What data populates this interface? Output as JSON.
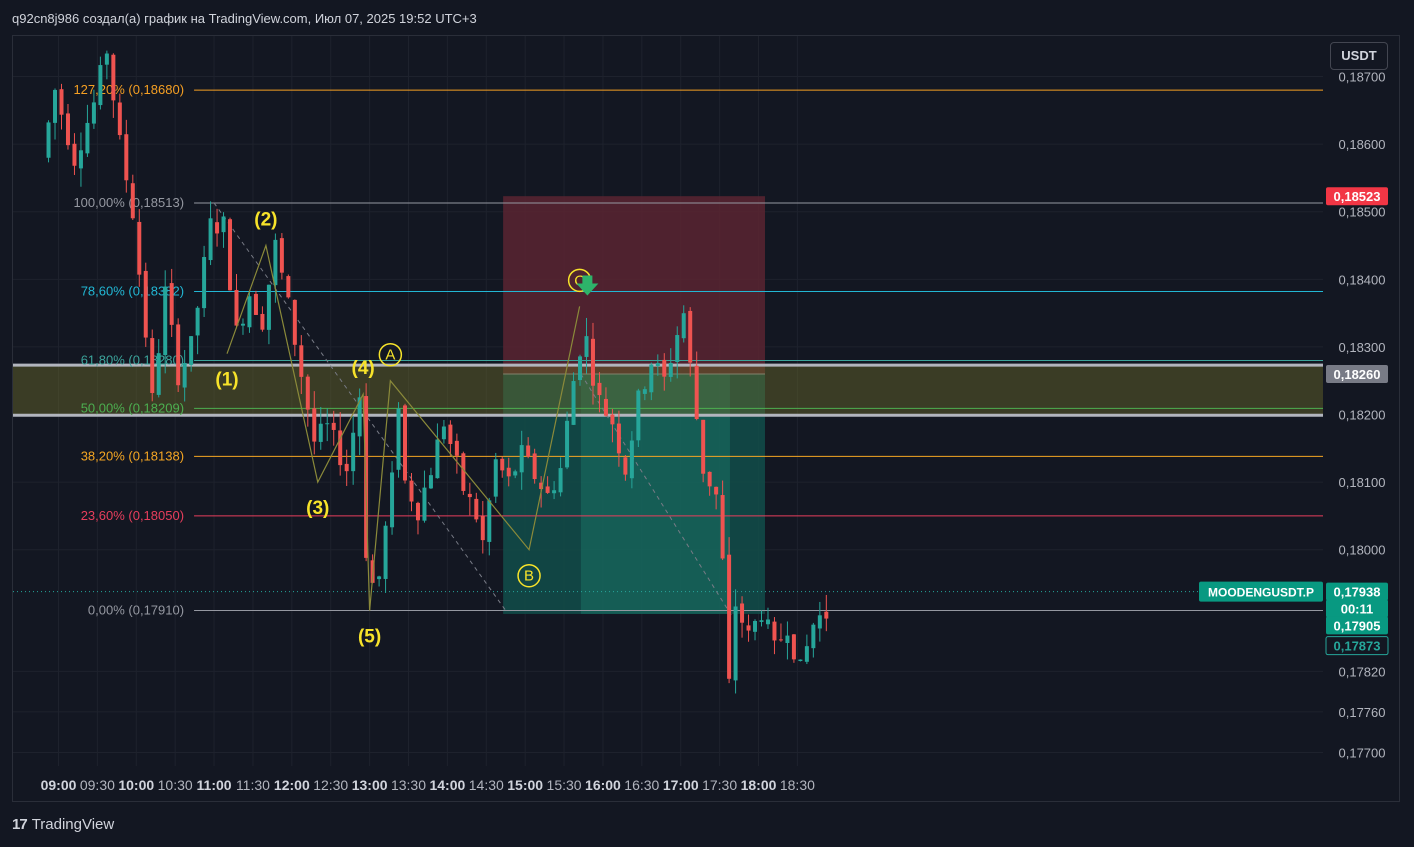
{
  "header": {
    "attribution": "q92cn8j986 создал(а) график на TradingView.com, Июл 07, 2025 19:52 UTC+3"
  },
  "currency_button": "USDT",
  "footer": {
    "logo_mark": "17",
    "brand": "TradingView"
  },
  "colors": {
    "background": "#131722",
    "up": "#26a69a",
    "down": "#ef5350",
    "label_yellow": "#f7e32a",
    "stop_zone": "#5a2531",
    "target_zone": "#124d4a"
  },
  "chart_data": {
    "type": "candlestick",
    "symbol_label": "MOODENGUSDT.P",
    "timeframe_note": "5-minute candles",
    "y_axis": {
      "range": [
        0.1768,
        0.1876
      ],
      "ticks": [
        "0,18700",
        "0,18600",
        "0,18500",
        "0,18400",
        "0,18300",
        "0,18200",
        "0,18100",
        "0,18000",
        "0,17820",
        "0,17760",
        "0,17700"
      ],
      "tick_values": [
        0.187,
        0.186,
        0.185,
        0.184,
        0.183,
        0.182,
        0.181,
        0.18,
        0.1782,
        0.1776,
        0.177
      ]
    },
    "x_axis": {
      "ticks": [
        "09:00",
        "09:30",
        "10:00",
        "10:30",
        "11:00",
        "11:30",
        "12:00",
        "12:30",
        "13:00",
        "13:30",
        "14:00",
        "14:30",
        "15:00",
        "15:30",
        "16:00",
        "16:30",
        "17:00",
        "17:30",
        "18:00",
        "18:30"
      ],
      "bold": [
        true,
        false,
        true,
        false,
        true,
        false,
        true,
        false,
        true,
        false,
        true,
        false,
        true,
        false,
        true,
        false,
        true,
        false,
        true,
        false
      ],
      "start_time": "08:50",
      "end_time": "18:52",
      "candle_minutes": 5
    },
    "price_path": [
      [
        "08:50",
        0.1858
      ],
      [
        "09:00",
        0.1868
      ],
      [
        "09:15",
        0.1858
      ],
      [
        "09:30",
        0.1866
      ],
      [
        "09:40",
        0.1874
      ],
      [
        "09:50",
        0.186
      ],
      [
        "10:00",
        0.185
      ],
      [
        "10:10",
        0.1832
      ],
      [
        "10:15",
        0.1822
      ],
      [
        "10:25",
        0.1838
      ],
      [
        "10:35",
        0.1826
      ],
      [
        "10:45",
        0.183
      ],
      [
        "10:55",
        0.1842
      ],
      [
        "11:00",
        0.1848
      ],
      [
        "11:10",
        0.1848
      ],
      [
        "11:20",
        0.1832
      ],
      [
        "11:30",
        0.1838
      ],
      [
        "11:40",
        0.1834
      ],
      [
        "11:50",
        0.1845
      ],
      [
        "12:00",
        0.1836
      ],
      [
        "12:10",
        0.1826
      ],
      [
        "12:20",
        0.1816
      ],
      [
        "12:30",
        0.1818
      ],
      [
        "12:45",
        0.1812
      ],
      [
        "12:55",
        0.1823
      ],
      [
        "13:00",
        0.18
      ],
      [
        "13:05",
        0.1795
      ],
      [
        "13:10",
        0.1796
      ],
      [
        "13:20",
        0.181
      ],
      [
        "13:25",
        0.1822
      ],
      [
        "13:30",
        0.181
      ],
      [
        "13:40",
        0.1806
      ],
      [
        "13:50",
        0.1812
      ],
      [
        "14:00",
        0.1819
      ],
      [
        "14:15",
        0.1809
      ],
      [
        "14:25",
        0.1805
      ],
      [
        "14:30",
        0.1801
      ],
      [
        "14:40",
        0.1813
      ],
      [
        "14:50",
        0.181
      ],
      [
        "15:00",
        0.1814
      ],
      [
        "15:10",
        0.1811
      ],
      [
        "15:20",
        0.1808
      ],
      [
        "15:30",
        0.1812
      ],
      [
        "15:40",
        0.1825
      ],
      [
        "15:48",
        0.1833
      ],
      [
        "15:55",
        0.1826
      ],
      [
        "16:00",
        0.1822
      ],
      [
        "16:10",
        0.1819
      ],
      [
        "16:20",
        0.1812
      ],
      [
        "16:30",
        0.1822
      ],
      [
        "16:40",
        0.1828
      ],
      [
        "16:50",
        0.1825
      ],
      [
        "17:00",
        0.1832
      ],
      [
        "17:05",
        0.1835
      ],
      [
        "17:10",
        0.1827
      ],
      [
        "17:20",
        0.1812
      ],
      [
        "17:30",
        0.1808
      ],
      [
        "17:35",
        0.1798
      ],
      [
        "17:38",
        0.1775
      ],
      [
        "17:45",
        0.1792
      ],
      [
        "17:55",
        0.1787
      ],
      [
        "18:05",
        0.1791
      ],
      [
        "18:15",
        0.1785
      ],
      [
        "18:25",
        0.1789
      ],
      [
        "18:35",
        0.1782
      ],
      [
        "18:45",
        0.1789
      ],
      [
        "18:52",
        0.17905
      ]
    ],
    "fibonacci": [
      {
        "label": "127,20% (0,18680)",
        "price": 0.1868,
        "color": "#f59f23"
      },
      {
        "label": "100,00% (0,18513)",
        "price": 0.18513,
        "color": "#9598a1"
      },
      {
        "label": "78,60% (0,18382)",
        "price": 0.18382,
        "color": "#22b7d4"
      },
      {
        "label": "61,80% (0,18280)",
        "price": 0.1828,
        "color": "#3ca49b"
      },
      {
        "label": "50,00% (0,18209)",
        "price": 0.18209,
        "color": "#4caf50"
      },
      {
        "label": "38,20% (0,18138)",
        "price": 0.18138,
        "color": "#f5a623"
      },
      {
        "label": "23,60% (0,18050)",
        "price": 0.1805,
        "color": "#e83e5c"
      },
      {
        "label": "0,00% (0,17910)",
        "price": 0.1791,
        "color": "#9598a1"
      }
    ],
    "fib_start_time": "11:00",
    "support_zone": {
      "top": 0.18273,
      "bottom": 0.18199
    },
    "position": {
      "type": "short",
      "start_time": "14:43",
      "entry_time": "15:43",
      "end_time": "18:05",
      "entry": 0.1826,
      "stop": 0.18523,
      "target": 0.17905
    },
    "waves": [
      {
        "label": "(1)",
        "time": "11:10",
        "price": 0.1829,
        "pos": "below",
        "circled": false
      },
      {
        "label": "(2)",
        "time": "11:40",
        "price": 0.1845,
        "pos": "above",
        "circled": false
      },
      {
        "label": "(3)",
        "time": "12:20",
        "price": 0.181,
        "pos": "below",
        "circled": false
      },
      {
        "label": "(4)",
        "time": "12:55",
        "price": 0.1823,
        "pos": "above",
        "circled": false
      },
      {
        "label": "(5)",
        "time": "13:00",
        "price": 0.1791,
        "pos": "below",
        "circled": false
      },
      {
        "label": "A",
        "time": "13:16",
        "price": 0.1825,
        "pos": "above",
        "circled": true
      },
      {
        "label": "B",
        "time": "15:03",
        "price": 0.18,
        "pos": "below",
        "circled": true
      },
      {
        "label": "C",
        "time": "15:42",
        "price": 0.1836,
        "pos": "above",
        "circled": true
      }
    ],
    "wave_path": [
      [
        "11:10",
        0.1829
      ],
      [
        "11:40",
        0.1845
      ],
      [
        "12:20",
        0.181
      ],
      [
        "12:55",
        0.1823
      ],
      [
        "13:00",
        0.1791
      ]
    ],
    "abc_path": [
      [
        "13:00",
        0.1791
      ],
      [
        "13:16",
        0.1825
      ],
      [
        "15:03",
        0.18
      ],
      [
        "15:42",
        0.1836
      ]
    ],
    "trend_dashed": [
      {
        "from": [
          "11:00",
          0.18513
        ],
        "to": [
          "14:45",
          0.1791
        ]
      },
      {
        "from": [
          "15:43",
          0.1826
        ],
        "to": [
          "17:40",
          0.179
        ]
      }
    ],
    "signal_arrow": {
      "time": "15:48",
      "price": 0.18385,
      "direction": "down"
    },
    "last_price_dotted": 0.17938,
    "price_tags": [
      {
        "text": "0,18523",
        "price": 0.18523,
        "bg": "#f23645",
        "fg": "#ffffff"
      },
      {
        "text": "0,18260",
        "price": 0.1826,
        "bg": "#787b86",
        "fg": "#ffffff"
      },
      {
        "text": "0,17938",
        "price": 0.17938,
        "bg": "#089981",
        "fg": "#ffffff"
      },
      {
        "text": "00:11",
        "price": 0.17913,
        "bg": "#089981",
        "fg": "#ffffff"
      },
      {
        "text": "0,17905",
        "price": 0.17888,
        "bg": "#089981",
        "fg": "#ffffff"
      },
      {
        "text": "0,17873",
        "price": 0.17858,
        "bg": "#131722",
        "fg": "#26a69a",
        "outline": "#26a69a"
      }
    ]
  }
}
